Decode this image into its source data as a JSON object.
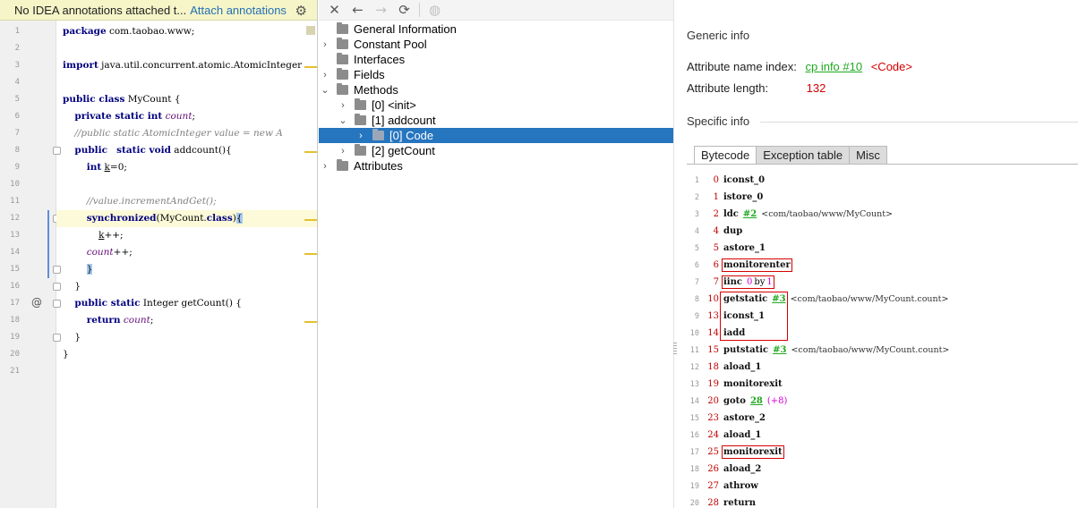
{
  "banner": {
    "message": "No IDEA annotations attached t...",
    "link": "Attach annotations",
    "gear_icon": "gear-icon"
  },
  "editor": {
    "lines": [
      {
        "n": "1",
        "segments": [
          {
            "t": "package",
            "c": "kw"
          },
          {
            "t": " com.taobao.www;"
          }
        ]
      },
      {
        "n": "2",
        "segments": []
      },
      {
        "n": "3",
        "segments": [
          {
            "t": "import",
            "c": "kw"
          },
          {
            "t": " java.util.concurrent.atomic.AtomicInteger"
          }
        ]
      },
      {
        "n": "4",
        "segments": []
      },
      {
        "n": "5",
        "segments": [
          {
            "t": "public class",
            "c": "kw"
          },
          {
            "t": " MyCount {"
          }
        ]
      },
      {
        "n": "6",
        "segments": [
          {
            "t": "    "
          },
          {
            "t": "private static int",
            "c": "kw"
          },
          {
            "t": " "
          },
          {
            "t": "count",
            "c": "fld"
          },
          {
            "t": ";"
          }
        ]
      },
      {
        "n": "7",
        "segments": [
          {
            "t": "    "
          },
          {
            "t": "//public static AtomicInteger value = new A",
            "c": "cmt"
          }
        ]
      },
      {
        "n": "8",
        "segments": [
          {
            "t": "    "
          },
          {
            "t": "public",
            "c": "kw"
          },
          {
            "t": "   "
          },
          {
            "t": "static void",
            "c": "kw"
          },
          {
            "t": " addcount(){"
          }
        ]
      },
      {
        "n": "9",
        "segments": [
          {
            "t": "        "
          },
          {
            "t": "int",
            "c": "kw"
          },
          {
            "t": " "
          },
          {
            "t": "k",
            "c": "ul"
          },
          {
            "t": "=0;"
          }
        ]
      },
      {
        "n": "10",
        "segments": []
      },
      {
        "n": "11",
        "segments": [
          {
            "t": "        "
          },
          {
            "t": "//value.incrementAndGet();",
            "c": "cmt"
          }
        ]
      },
      {
        "n": "12",
        "segments": [
          {
            "t": "        "
          },
          {
            "t": "synchronized",
            "c": "kw"
          },
          {
            "t": "(MyCount."
          },
          {
            "t": "class",
            "c": "kw"
          },
          {
            "t": ")"
          },
          {
            "t": "{",
            "c": "brk"
          }
        ]
      },
      {
        "n": "13",
        "segments": [
          {
            "t": "            "
          },
          {
            "t": "k",
            "c": "ul"
          },
          {
            "t": "++;"
          }
        ]
      },
      {
        "n": "14",
        "segments": [
          {
            "t": "        "
          },
          {
            "t": "count",
            "c": "fld"
          },
          {
            "t": "++;"
          }
        ]
      },
      {
        "n": "15",
        "segments": [
          {
            "t": "        "
          },
          {
            "t": "}",
            "c": "brk"
          }
        ]
      },
      {
        "n": "16",
        "segments": [
          {
            "t": "    }"
          }
        ]
      },
      {
        "n": "17",
        "segments": [
          {
            "t": "    "
          },
          {
            "t": "public static",
            "c": "kw"
          },
          {
            "t": " Integer getCount() {"
          }
        ]
      },
      {
        "n": "18",
        "segments": [
          {
            "t": "        "
          },
          {
            "t": "return",
            "c": "kw"
          },
          {
            "t": " "
          },
          {
            "t": "count",
            "c": "fld"
          },
          {
            "t": ";"
          }
        ]
      },
      {
        "n": "19",
        "segments": [
          {
            "t": "    }"
          }
        ]
      },
      {
        "n": "20",
        "segments": [
          {
            "t": "}"
          }
        ]
      },
      {
        "n": "21",
        "segments": []
      }
    ]
  },
  "toolbar": {
    "icons": [
      "close-icon",
      "back-icon",
      "forward-icon",
      "refresh-icon",
      "web-icon"
    ]
  },
  "tree": {
    "items": [
      {
        "label": "General Information",
        "depth": 0,
        "arrow": "",
        "selected": false
      },
      {
        "label": "Constant Pool",
        "depth": 0,
        "arrow": "›",
        "selected": false
      },
      {
        "label": "Interfaces",
        "depth": 0,
        "arrow": "",
        "selected": false
      },
      {
        "label": "Fields",
        "depth": 0,
        "arrow": "›",
        "selected": false
      },
      {
        "label": "Methods",
        "depth": 0,
        "arrow": "⌄",
        "selected": false
      },
      {
        "label": "[0] <init>",
        "depth": 1,
        "arrow": "›",
        "selected": false
      },
      {
        "label": "[1] addcount",
        "depth": 1,
        "arrow": "⌄",
        "selected": false
      },
      {
        "label": "[0] Code",
        "depth": 2,
        "arrow": "›",
        "selected": true
      },
      {
        "label": "[2] getCount",
        "depth": 1,
        "arrow": "›",
        "selected": false
      },
      {
        "label": "Attributes",
        "depth": 0,
        "arrow": "›",
        "selected": false
      }
    ]
  },
  "info": {
    "generic_title": "Generic info",
    "attr_name_label": "Attribute name index:",
    "attr_name_link": "cp info #10",
    "attr_name_value": "<Code>",
    "attr_length_label": "Attribute length:",
    "attr_length_value": "132",
    "specific_title": "Specific info",
    "tabs": [
      "Bytecode",
      "Exception table",
      "Misc"
    ],
    "active_tab": "Bytecode"
  },
  "bytecode": [
    {
      "n": "1",
      "off": "0",
      "ins": "iconst_0"
    },
    {
      "n": "2",
      "off": "1",
      "ins": "istore_0"
    },
    {
      "n": "3",
      "off": "2",
      "ins": "ldc",
      "ref": "#2",
      "cmt": "<com/taobao/www/MyCount>"
    },
    {
      "n": "4",
      "off": "4",
      "ins": "dup"
    },
    {
      "n": "5",
      "off": "5",
      "ins": "astore_1"
    },
    {
      "n": "6",
      "off": "6",
      "ins": "monitorenter",
      "box": true
    },
    {
      "n": "7",
      "off": "7",
      "ins": "iinc",
      "iinc": {
        "a": "0",
        "by": "by",
        "b": "1"
      },
      "box": true
    },
    {
      "n": "8",
      "off": "10",
      "ins": "getstatic",
      "ref": "#3",
      "cmt": "<com/taobao/www/MyCount.count>"
    },
    {
      "n": "9",
      "off": "13",
      "ins": "iconst_1"
    },
    {
      "n": "10",
      "off": "14",
      "ins": "iadd"
    },
    {
      "n": "11",
      "off": "15",
      "ins": "putstatic",
      "ref": "#3",
      "cmt": "<com/taobao/www/MyCount.count>"
    },
    {
      "n": "12",
      "off": "18",
      "ins": "aload_1"
    },
    {
      "n": "13",
      "off": "19",
      "ins": "monitorexit"
    },
    {
      "n": "14",
      "off": "20",
      "ins": "goto",
      "ref": "28",
      "extra": "(+8)"
    },
    {
      "n": "15",
      "off": "23",
      "ins": "astore_2"
    },
    {
      "n": "16",
      "off": "24",
      "ins": "aload_1"
    },
    {
      "n": "17",
      "off": "25",
      "ins": "monitorexit",
      "box": true
    },
    {
      "n": "18",
      "off": "26",
      "ins": "aload_2"
    },
    {
      "n": "19",
      "off": "27",
      "ins": "athrow"
    },
    {
      "n": "20",
      "off": "28",
      "ins": "return"
    }
  ],
  "colors": {
    "selection": "#2675bf",
    "keyword": "#000080",
    "link_green": "#1fa81f",
    "highlight_red": "#d40000"
  }
}
